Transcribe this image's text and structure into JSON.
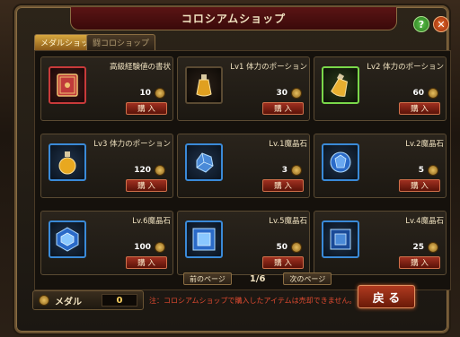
{
  "window": {
    "title": "コロシアムショップ"
  },
  "tabs": [
    {
      "label": "メダルショップ",
      "active": true
    },
    {
      "label": "闘コロショップ",
      "active": false
    }
  ],
  "items": [
    {
      "name": "高級経験値の書状",
      "price": "10",
      "buy_label": "購 入",
      "icon": "book-icon",
      "frame": "red"
    },
    {
      "name": "Lv1 体力のポーション",
      "price": "30",
      "buy_label": "購 入",
      "icon": "potion-icon",
      "frame": "dark"
    },
    {
      "name": "Lv2 体力のポーション",
      "price": "60",
      "buy_label": "購 入",
      "icon": "potion-icon",
      "frame": "green"
    },
    {
      "name": "Lv3 体力のポーション",
      "price": "120",
      "buy_label": "購 入",
      "icon": "potion-icon",
      "frame": "blue"
    },
    {
      "name": "Lv.1魔晶石",
      "price": "3",
      "buy_label": "購 入",
      "icon": "crystal-icon",
      "frame": "blue"
    },
    {
      "name": "Lv.2魔晶石",
      "price": "5",
      "buy_label": "購 入",
      "icon": "crystal-icon",
      "frame": "blue"
    },
    {
      "name": "Lv.6魔晶石",
      "price": "100",
      "buy_label": "購 入",
      "icon": "crystal-icon",
      "frame": "blue"
    },
    {
      "name": "Lv.5魔晶石",
      "price": "50",
      "buy_label": "購 入",
      "icon": "crystal-icon",
      "frame": "blue"
    },
    {
      "name": "Lv.4魔晶石",
      "price": "25",
      "buy_label": "購 入",
      "icon": "crystal-icon",
      "frame": "blue"
    }
  ],
  "pager": {
    "prev_label": "前のページ",
    "page": "1/6",
    "next_label": "次のページ"
  },
  "footer": {
    "medal_label": "メダル",
    "medal_value": "0",
    "notice": "注：コロシアムショップで購入したアイテムは売却できません。",
    "back_label": "戻 る"
  },
  "controls": {
    "help": "?",
    "close": "✕"
  },
  "colors": {
    "accent": "#8a6d42",
    "buy": "#a03020",
    "title_bg": "#5a1414"
  }
}
